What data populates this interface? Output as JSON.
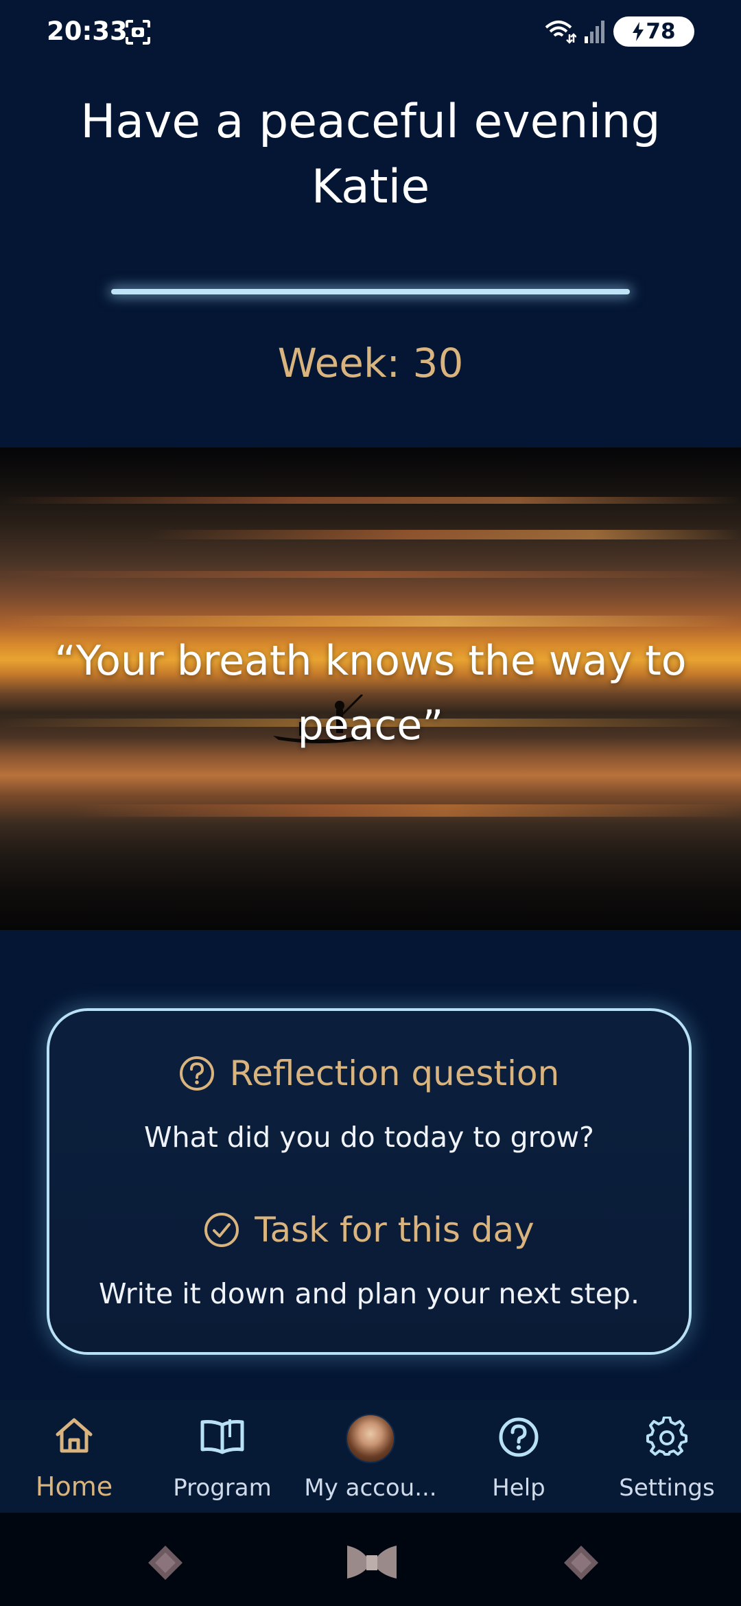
{
  "status_bar": {
    "time": "20:33",
    "battery": "78",
    "icons": [
      "screenshot-icon",
      "wifi-icon",
      "signal-icon",
      "charging-icon"
    ]
  },
  "header": {
    "greeting_line1": "Have a peaceful evening",
    "greeting_line2": "Katie",
    "week_label": "Week: 30"
  },
  "hero": {
    "quote": "“Your breath knows the way to peace”"
  },
  "card": {
    "reflection_title": "Reflection question",
    "reflection_text": "What did you do today to grow?",
    "task_title": "Task for this day",
    "task_text": "Write it down and plan your next step."
  },
  "bottom_nav": {
    "items": [
      {
        "label": "Home",
        "icon": "home-icon",
        "active": true
      },
      {
        "label": "Program",
        "icon": "book-icon",
        "active": false
      },
      {
        "label": "My accou...",
        "icon": "avatar",
        "active": false
      },
      {
        "label": "Help",
        "icon": "help-icon",
        "active": false
      },
      {
        "label": "Settings",
        "icon": "gear-icon",
        "active": false
      }
    ]
  },
  "colors": {
    "background": "#041633",
    "accent_gold": "#d9b47e",
    "divider_blue": "#bfe4f7",
    "card_border": "#b9e1f5"
  }
}
